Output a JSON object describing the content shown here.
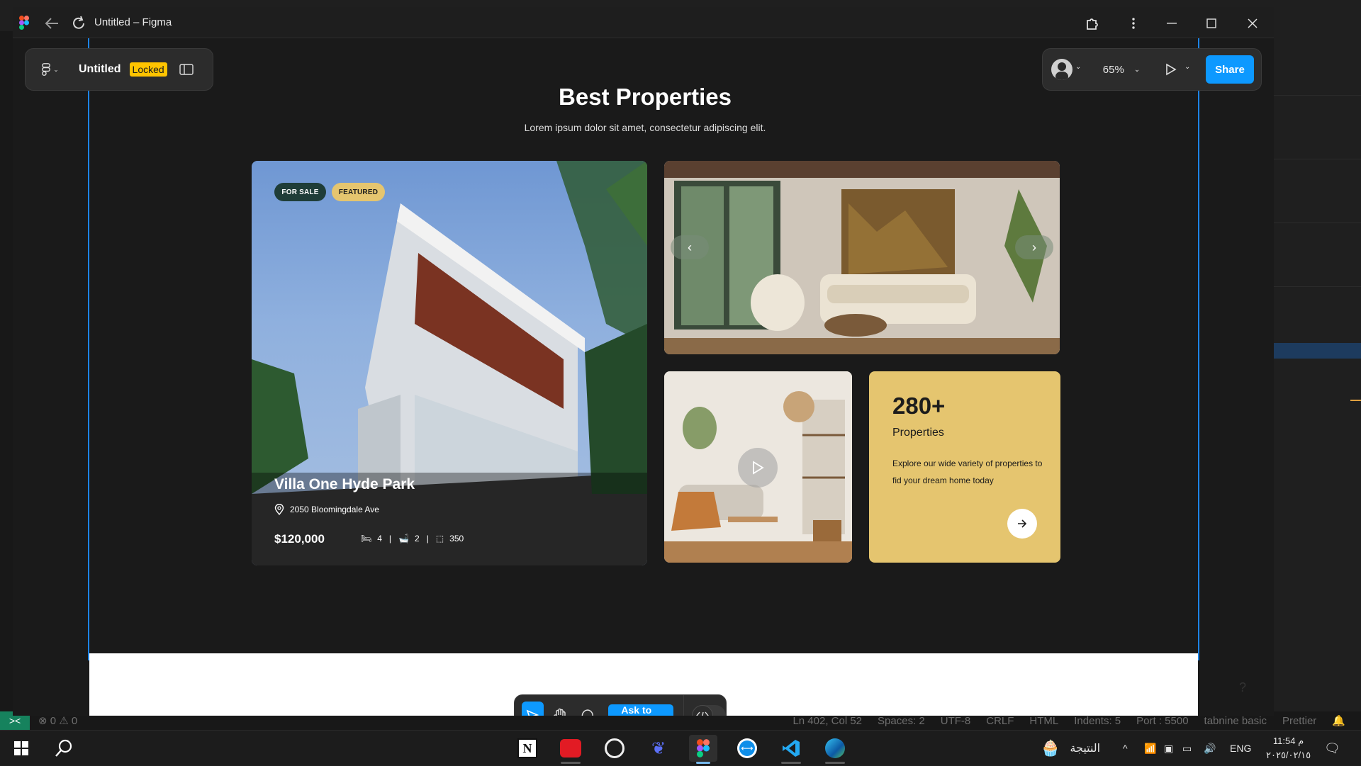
{
  "figma": {
    "window_title": "Untitled – Figma",
    "file_name": "Untitled",
    "locked_label": "Locked",
    "zoom": "65%",
    "share_label": "Share",
    "ask_to_edit_label": "Ask to edit"
  },
  "design": {
    "title": "Best Properties",
    "subtitle": "Lorem ipsum dolor sit amet, consectetur adipiscing elit.",
    "featured": {
      "badges": [
        "FOR SALE",
        "FEATURED"
      ],
      "name": "Villa One Hyde Park",
      "address": "2050 Bloomingdale Ave",
      "price": "$120,000",
      "beds": "4",
      "baths": "2",
      "area": "350"
    },
    "stat": {
      "value": "280+",
      "label": "Properties",
      "description": "Explore our wide variety of properties to fid your dream home today"
    }
  },
  "vscode_status": {
    "errors": "0",
    "warnings": "0",
    "cursor": "Ln 402, Col 52",
    "spaces": "Spaces: 2",
    "encoding": "UTF-8",
    "eol": "CRLF",
    "language": "HTML",
    "indents": "Indents: 5",
    "port": "Port : 5500",
    "tabnine": "tabnine basic",
    "prettier": "Prettier"
  },
  "taskbar": {
    "weather_text": "النتيجة",
    "language": "ENG",
    "time": "11:54 م",
    "date": "٢٠٢٥/٠٢/١٥"
  },
  "colors": {
    "accent": "#0d99ff",
    "frame_outline": "#1d84e6",
    "stat_card": "#e5c56f",
    "locked_badge": "#ffc400"
  }
}
